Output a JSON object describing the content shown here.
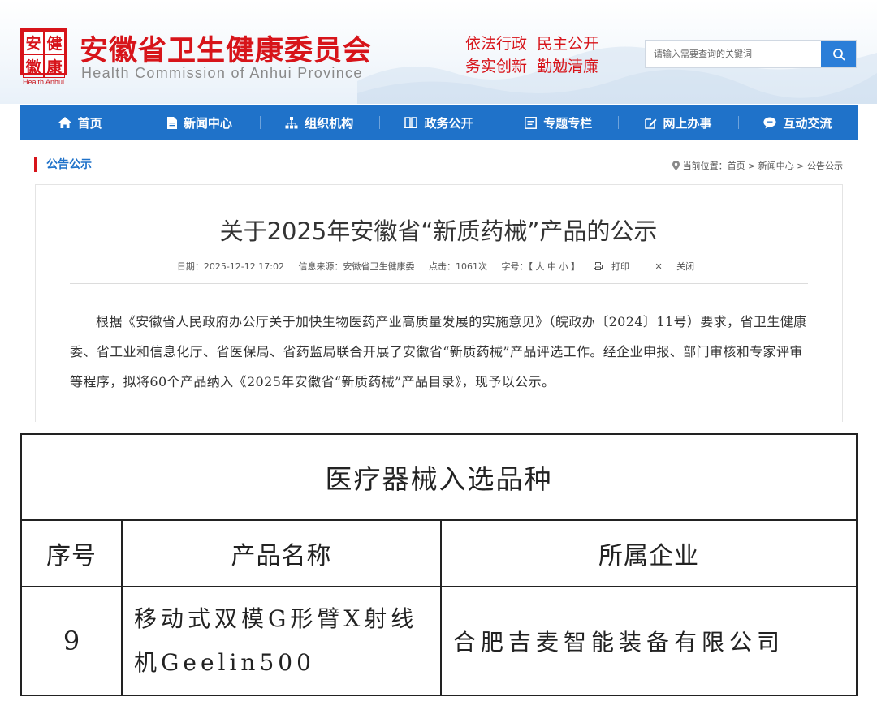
{
  "header": {
    "logo_chars": [
      "安",
      "健",
      "徽",
      "康"
    ],
    "logo_tag": "Health Anhui",
    "title": "安徽省卫生健康委员会",
    "subtitle": "Health Commission of Anhui Province",
    "motto_line1": "依法行政  民主公开",
    "motto_line2": "务实创新  勤勉清廉",
    "search_placeholder": "请输入需要查询的关键词"
  },
  "nav": {
    "items": [
      {
        "label": "首页",
        "icon": "home-icon"
      },
      {
        "label": "新闻中心",
        "icon": "document-icon"
      },
      {
        "label": "组织机构",
        "icon": "org-chart-icon"
      },
      {
        "label": "政务公开",
        "icon": "book-icon"
      },
      {
        "label": "专题专栏",
        "icon": "list-icon"
      },
      {
        "label": "网上办事",
        "icon": "edit-icon"
      },
      {
        "label": "互动交流",
        "icon": "chat-icon"
      }
    ]
  },
  "section": {
    "label": "公告公示",
    "breadcrumb": "当前位置：首页 > 新闻中心 > 公告公示"
  },
  "article": {
    "title": "关于2025年安徽省“新质药械”产品的公示",
    "date": "日期：2025-12-12 17:02",
    "source": "信息来源：安徽省卫生健康委",
    "hits": "点击：1061次",
    "font_size": "字号：【 大 中 小 】",
    "print": "打印",
    "close": "关闭",
    "body": "根据《安徽省人民政府办公厅关于加快生物医药产业高质量发展的实施意见》（皖政办〔2024〕11号）要求，省卫生健康委、省工业和信息化厅、省医保局、省药监局联合开展了安徽省“新质药械”产品评选工作。经企业申报、部门审核和专家评审等程序，拟将60个产品纳入《2025年安徽省“新质药械”产品目录》，现予以公示。"
  },
  "table": {
    "caption": "医疗器械入选品种",
    "headers": [
      "序号",
      "产品名称",
      "所属企业"
    ],
    "rows": [
      {
        "no": "9",
        "product": "移动式双模G形臂X射线机Geelin500",
        "company": "合肥吉麦智能装备有限公司"
      }
    ]
  },
  "colors": {
    "brand_red": "#d7141a",
    "nav_blue": "#1f72c9",
    "search_blue": "#2b7ed8"
  }
}
